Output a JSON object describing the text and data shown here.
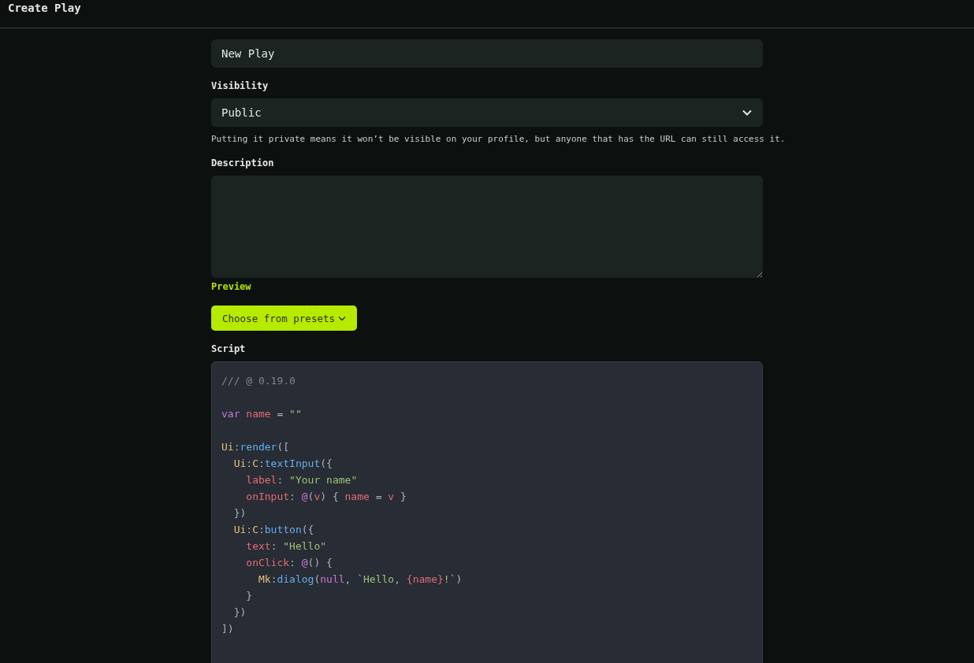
{
  "header": {
    "title": "Create Play"
  },
  "title_field": {
    "value": "New Play"
  },
  "visibility": {
    "label": "Visibility",
    "value": "Public",
    "caption": "Putting it private means it won’t be visible on your profile, but anyone that has the URL can still access it."
  },
  "description": {
    "label": "Description",
    "preview_link": "Preview"
  },
  "presets_button": {
    "label": "Choose from presets"
  },
  "script": {
    "label": "Script",
    "lines": [
      {
        "kind": "code",
        "tokens": [
          {
            "text": "/// @ 0.19.0",
            "kind": "comment"
          }
        ]
      },
      {
        "kind": "blank"
      },
      {
        "kind": "code",
        "tokens": [
          {
            "text": "var",
            "kind": "keyword"
          },
          {
            "text": " name",
            "kind": "variable"
          },
          {
            "text": " = ",
            "kind": "plain"
          },
          {
            "text": "\"\"",
            "kind": "string"
          }
        ]
      },
      {
        "kind": "blank"
      },
      {
        "kind": "code",
        "tokens": [
          {
            "text": "Ui",
            "kind": "namespace"
          },
          {
            "text": ":",
            "kind": "plain"
          },
          {
            "text": "render",
            "kind": "function"
          },
          {
            "text": "([",
            "kind": "plain"
          }
        ]
      },
      {
        "kind": "code",
        "tokens": [
          {
            "text": "  Ui",
            "kind": "namespace"
          },
          {
            "text": ":",
            "kind": "plain"
          },
          {
            "text": "C",
            "kind": "namespace"
          },
          {
            "text": ":",
            "kind": "plain"
          },
          {
            "text": "textInput",
            "kind": "function"
          },
          {
            "text": "({",
            "kind": "plain"
          }
        ]
      },
      {
        "kind": "code",
        "tokens": [
          {
            "text": "    label",
            "kind": "variable"
          },
          {
            "text": ": ",
            "kind": "plain"
          },
          {
            "text": "\"Your name\"",
            "kind": "string"
          }
        ]
      },
      {
        "kind": "code",
        "tokens": [
          {
            "text": "    onInput",
            "kind": "variable"
          },
          {
            "text": ": ",
            "kind": "plain"
          },
          {
            "text": "@",
            "kind": "keyword"
          },
          {
            "text": "(",
            "kind": "plain"
          },
          {
            "text": "v",
            "kind": "variable"
          },
          {
            "text": ") { ",
            "kind": "plain"
          },
          {
            "text": "name",
            "kind": "variable"
          },
          {
            "text": " = ",
            "kind": "plain"
          },
          {
            "text": "v",
            "kind": "variable"
          },
          {
            "text": " }",
            "kind": "plain"
          }
        ]
      },
      {
        "kind": "code",
        "tokens": [
          {
            "text": "  })",
            "kind": "plain"
          }
        ]
      },
      {
        "kind": "code",
        "tokens": [
          {
            "text": "  Ui",
            "kind": "namespace"
          },
          {
            "text": ":",
            "kind": "plain"
          },
          {
            "text": "C",
            "kind": "namespace"
          },
          {
            "text": ":",
            "kind": "plain"
          },
          {
            "text": "button",
            "kind": "function"
          },
          {
            "text": "({",
            "kind": "plain"
          }
        ]
      },
      {
        "kind": "code",
        "tokens": [
          {
            "text": "    text",
            "kind": "variable"
          },
          {
            "text": ": ",
            "kind": "plain"
          },
          {
            "text": "\"Hello\"",
            "kind": "string"
          }
        ]
      },
      {
        "kind": "code",
        "tokens": [
          {
            "text": "    onClick",
            "kind": "variable"
          },
          {
            "text": ": ",
            "kind": "plain"
          },
          {
            "text": "@",
            "kind": "keyword"
          },
          {
            "text": "() {",
            "kind": "plain"
          }
        ]
      },
      {
        "kind": "code",
        "tokens": [
          {
            "text": "      Mk",
            "kind": "namespace"
          },
          {
            "text": ":",
            "kind": "plain"
          },
          {
            "text": "dialog",
            "kind": "function"
          },
          {
            "text": "(",
            "kind": "plain"
          },
          {
            "text": "null",
            "kind": "keyword"
          },
          {
            "text": ", ",
            "kind": "plain"
          },
          {
            "text": "`Hello, ",
            "kind": "string"
          },
          {
            "text": "{name}",
            "kind": "variable"
          },
          {
            "text": "!`",
            "kind": "string"
          },
          {
            "text": ")",
            "kind": "plain"
          }
        ]
      },
      {
        "kind": "code",
        "tokens": [
          {
            "text": "    }",
            "kind": "plain"
          }
        ]
      },
      {
        "kind": "code",
        "tokens": [
          {
            "text": "  })",
            "kind": "plain"
          }
        ]
      },
      {
        "kind": "code",
        "tokens": [
          {
            "text": "])",
            "kind": "plain"
          }
        ]
      }
    ]
  }
}
